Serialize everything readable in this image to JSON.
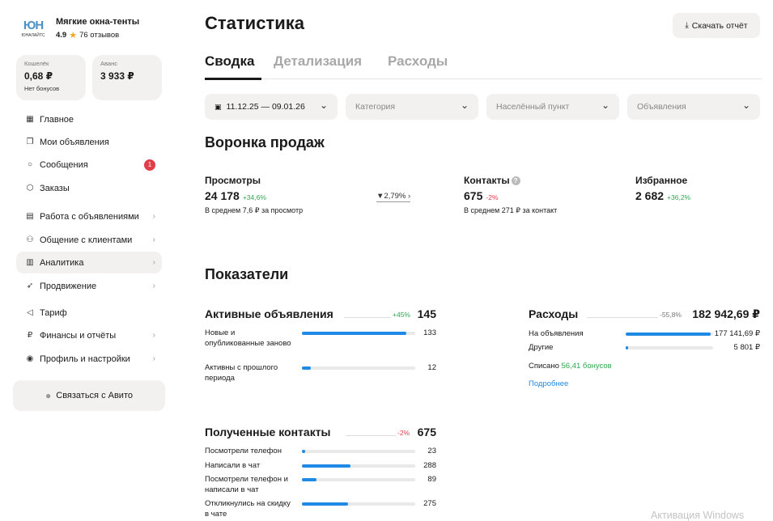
{
  "seller": {
    "logo_big": "ЮН",
    "logo_small": "ЮНАЛАЙТС",
    "name": "Мягкие окна-тенты",
    "rating": "4.9",
    "reviews": "76 отзывов"
  },
  "wallet": {
    "label": "Кошелёк",
    "value": "0,68 ₽",
    "sub": "Нет бонусов"
  },
  "advance": {
    "label": "Аванс",
    "value": "3 933 ₽"
  },
  "menu": {
    "items": [
      {
        "label": "Главное",
        "icon": "grid-icon"
      },
      {
        "label": "Мои объявления",
        "icon": "ads-icon"
      },
      {
        "label": "Сообщения",
        "icon": "chat-icon",
        "badge": "1"
      },
      {
        "label": "Заказы",
        "icon": "box-icon"
      },
      {
        "label": "Работа с объявлениями",
        "icon": "list-icon"
      },
      {
        "label": "Общение с клиентами",
        "icon": "people-icon"
      },
      {
        "label": "Аналитика",
        "icon": "chart-icon"
      },
      {
        "label": "Продвижение",
        "icon": "rocket-icon"
      },
      {
        "label": "Тариф",
        "icon": "megaphone-icon"
      },
      {
        "label": "Финансы и отчёты",
        "icon": "ruble-icon"
      },
      {
        "label": "Профиль и настройки",
        "icon": "profile-icon"
      }
    ],
    "contact_button": "Связаться с Авито"
  },
  "page": {
    "title": "Статистика",
    "download_label": "Скачать отчёт",
    "tabs": [
      "Сводка",
      "Детализация",
      "Расходы"
    ]
  },
  "filters": {
    "date": "11.12.25 — 09.01.26",
    "category": "Категория",
    "locality": "Населённый пункт",
    "ads": "Объявления"
  },
  "funnel": {
    "title": "Воронка продаж",
    "views": {
      "label": "Просмотры",
      "value": "24 178",
      "delta": "+34,6%",
      "sub": "В среднем 7,6 ₽ за просмотр"
    },
    "conversion": "2,79%",
    "contacts": {
      "label": "Контакты",
      "value": "675",
      "delta": "-2%",
      "sub": "В среднем 271 ₽ за контакт"
    },
    "favorites": {
      "label": "Избранное",
      "value": "2 682",
      "delta": "+36,2%"
    }
  },
  "indicators": {
    "title": "Показатели",
    "active_ads": {
      "title": "Активные объявления",
      "delta": "+45%",
      "value": "145",
      "rows": [
        {
          "label": "Новые и опубликованные заново",
          "value": "133",
          "share": 0.92
        },
        {
          "label": "Активны с прошлого периода",
          "value": "12",
          "share": 0.08
        }
      ]
    },
    "expenses": {
      "title": "Расходы",
      "delta": "-55,8%",
      "value": "182 942,69 ₽",
      "rows": [
        {
          "label": "На объявления",
          "value": "177 141,69 ₽",
          "share": 0.97
        },
        {
          "label": "Другие",
          "value": "5 801 ₽",
          "share": 0.03
        }
      ],
      "written_off_label": "Списано",
      "written_off_value": "56,41 бонусов",
      "more_link": "Подробнее"
    },
    "received_contacts": {
      "title": "Полученные контакты",
      "delta": "-2%",
      "value": "675",
      "rows": [
        {
          "label": "Посмотрели телефон",
          "value": "23",
          "share": 0.03
        },
        {
          "label": "Написали в чат",
          "value": "288",
          "share": 0.43
        },
        {
          "label": "Посмотрели телефон и написали в чат",
          "value": "89",
          "share": 0.13
        },
        {
          "label": "Откликнулись на скидку в чате",
          "value": "275",
          "share": 0.41
        }
      ]
    }
  },
  "watermark": "Активация Windows",
  "colors": {
    "accent": "#1f8ae6",
    "positive": "#2fa84f",
    "negative": "#e23d4b",
    "panel": "#f2f1f0"
  }
}
